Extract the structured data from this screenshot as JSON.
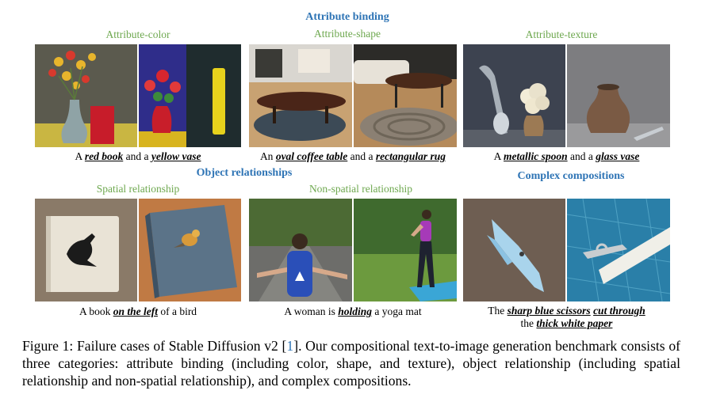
{
  "headings": {
    "attribute_binding": "Attribute binding",
    "object_relationships": "Object relationships",
    "complex_compositions": "Complex compositions"
  },
  "subheadings": {
    "color": "Attribute-color",
    "shape": "Attribute-shape",
    "texture": "Attribute-texture",
    "spatial": "Spatial relationship",
    "nonspatial": "Non-spatial relationship"
  },
  "captions": {
    "color": {
      "a": "A ",
      "b": "red book",
      "c": " and a ",
      "d": "yellow vase"
    },
    "shape": {
      "a": "An ",
      "b": "oval coffee table",
      "c": " and a ",
      "d": "rectangular rug"
    },
    "texture": {
      "a": "A ",
      "b": "metallic spoon",
      "c": " and a ",
      "d": "glass vase"
    },
    "spatial": {
      "a": "A book ",
      "b": "on the left",
      "c": " of a bird"
    },
    "nonspatial": {
      "a": "A woman is ",
      "b": "holding",
      "c": " a yoga mat"
    },
    "complex": {
      "a": "The ",
      "b": "sharp blue scissors",
      "c": " ",
      "d": "cut through",
      "e": "the ",
      "f": "thick white paper"
    }
  },
  "figure_caption": {
    "prefix": "Figure 1:  Failure cases of Stable Diffusion v2 [",
    "ref": "1",
    "suffix": "].  Our compositional text-to-image generation benchmark consists of three categories: attribute binding (including color, shape, and texture), object relationship (including spatial relationship and non-spatial relationship), and complex compositions."
  },
  "colors": {
    "heading_blue": "#2e74b5",
    "subheading_green": "#6ea84f"
  }
}
